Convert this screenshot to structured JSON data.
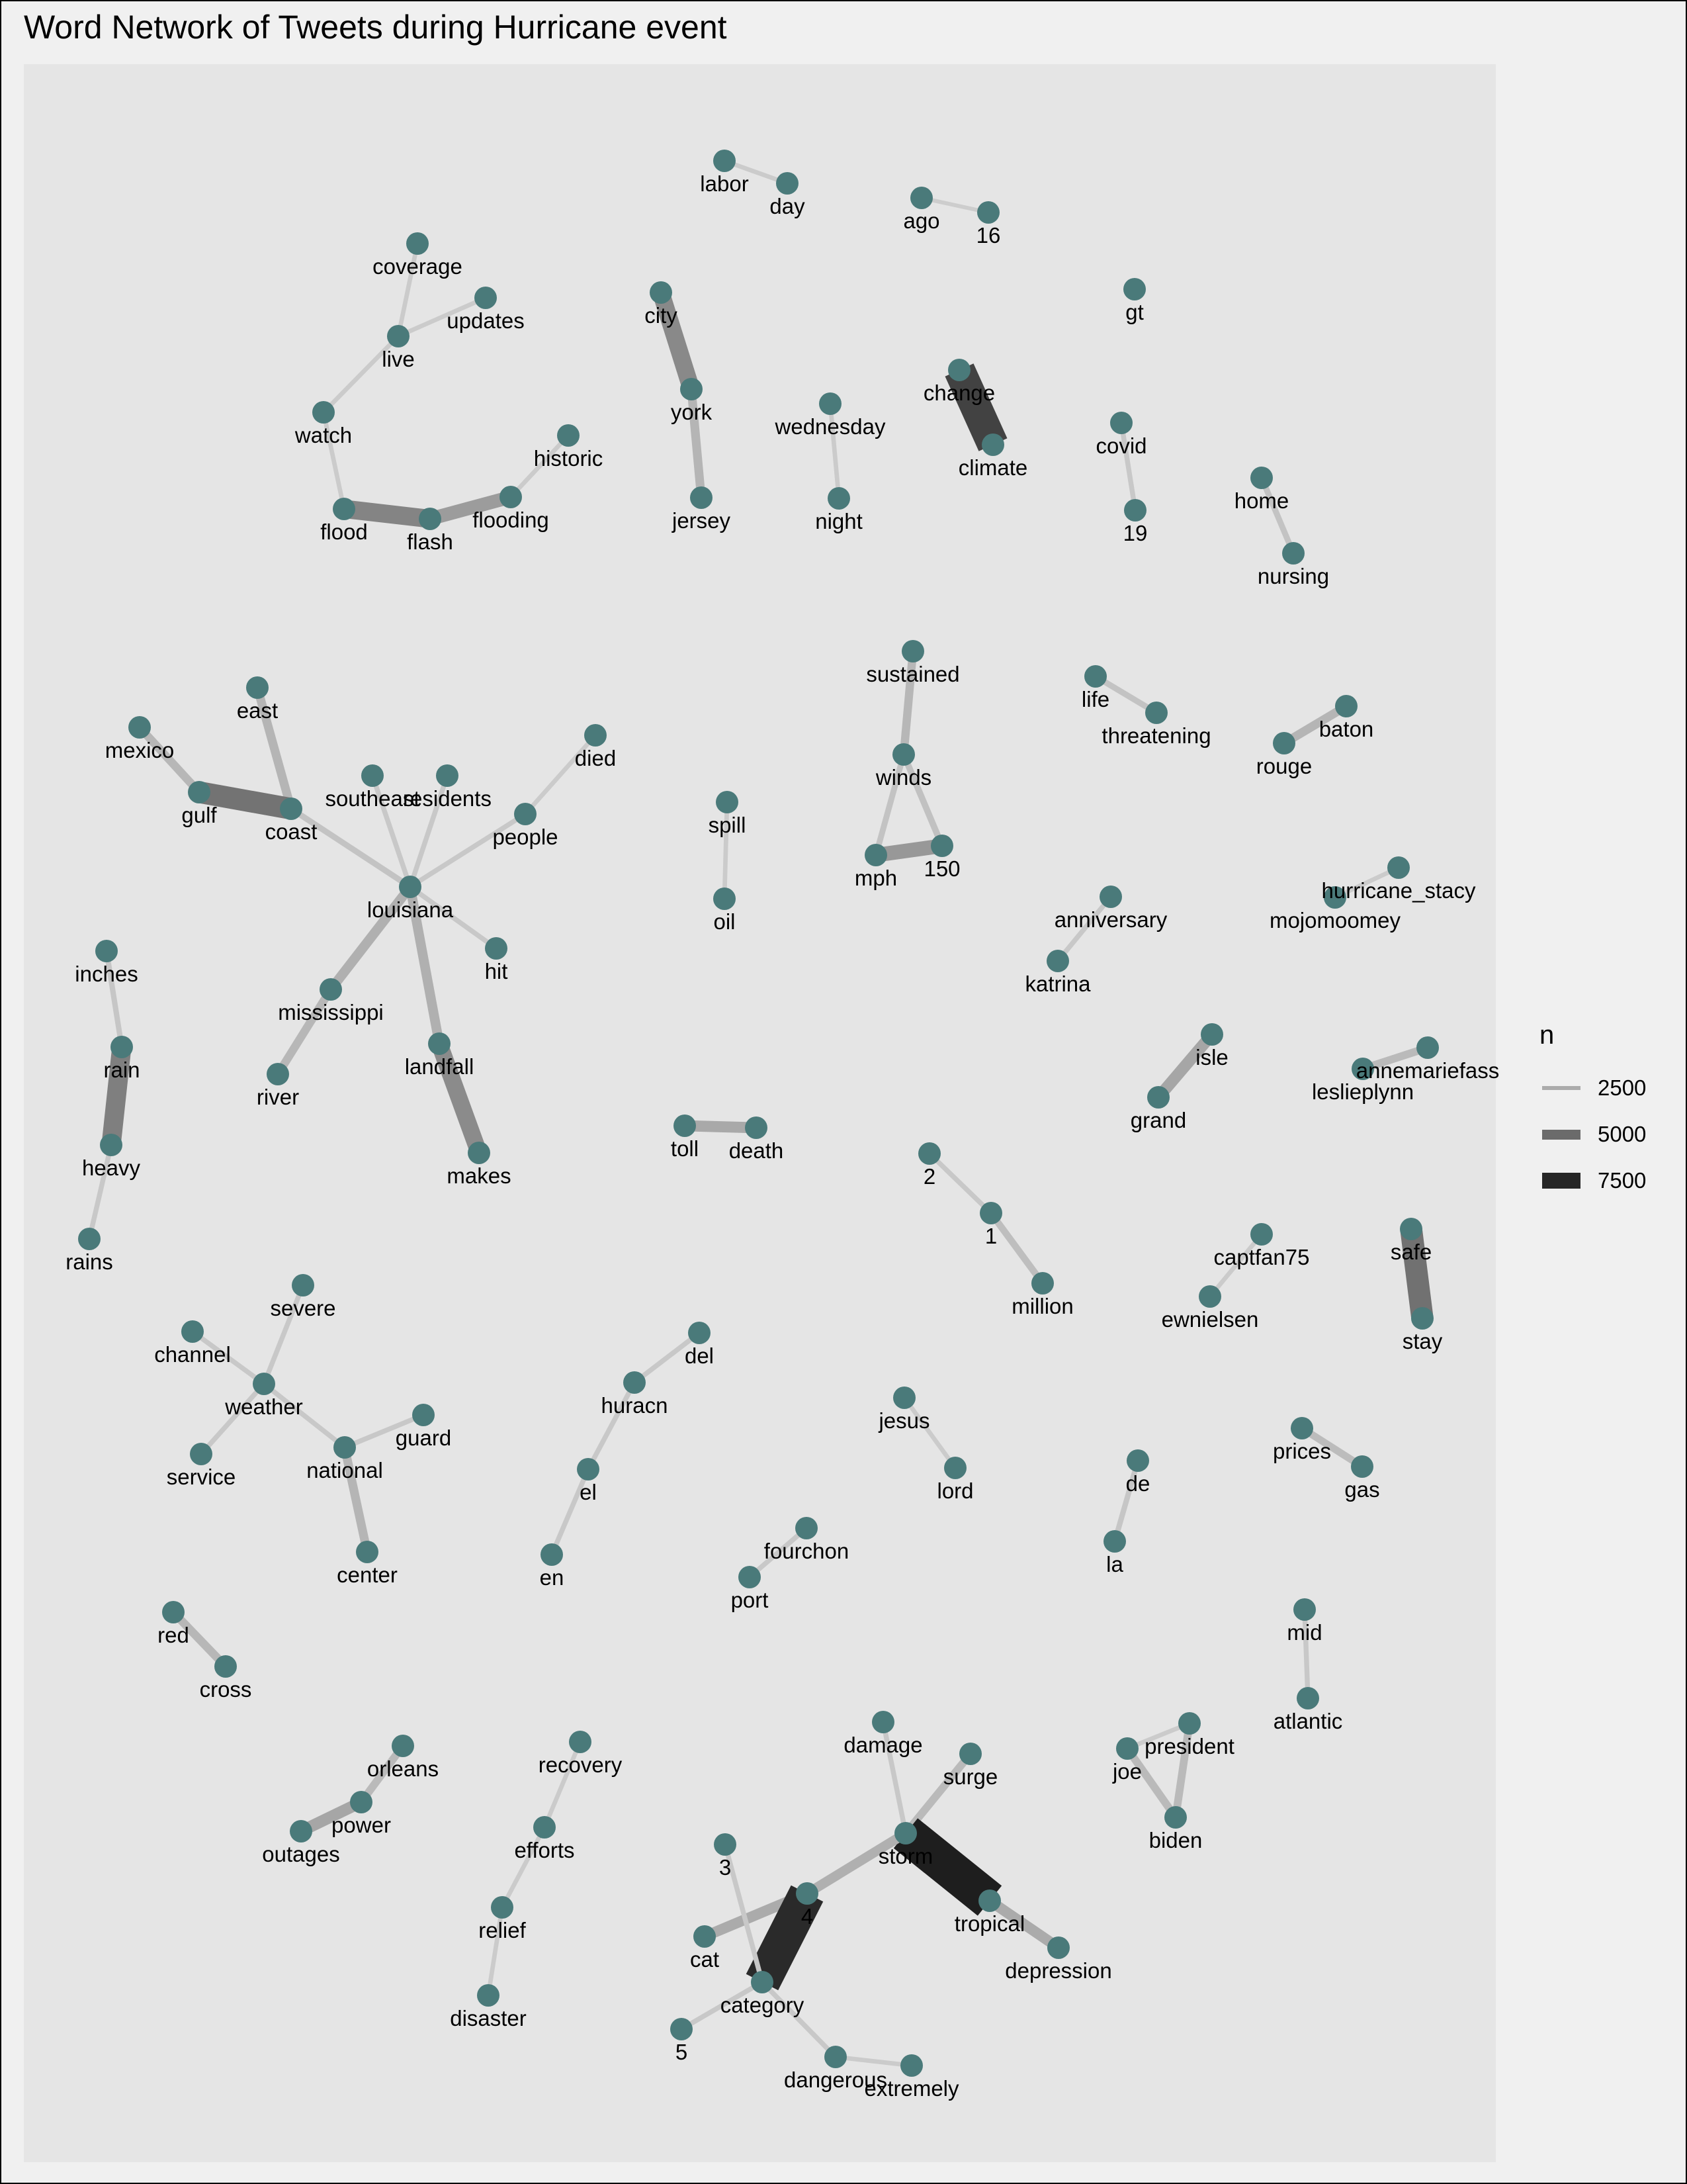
{
  "title": "Word Network of Tweets during Hurricane event",
  "colors": {
    "background": "#f0f0f0",
    "panel": "#e5e5e5",
    "node": "#4a7a7a"
  },
  "legend": {
    "title": "n",
    "entries": [
      {
        "label": "2500",
        "color": "#ababab",
        "weight": 2500
      },
      {
        "label": "5000",
        "color": "#6b6b6b",
        "weight": 5000
      },
      {
        "label": "7500",
        "color": "#262626",
        "weight": 7500
      }
    ]
  },
  "nodes": [
    {
      "id": "labor",
      "label": "labor"
    },
    {
      "id": "day",
      "label": "day"
    },
    {
      "id": "ago",
      "label": "ago"
    },
    {
      "id": "16",
      "label": "16"
    },
    {
      "id": "gt",
      "label": "gt"
    },
    {
      "id": "coverage",
      "label": "coverage"
    },
    {
      "id": "updates",
      "label": "updates"
    },
    {
      "id": "live",
      "label": "live"
    },
    {
      "id": "watch",
      "label": "watch"
    },
    {
      "id": "flood",
      "label": "flood"
    },
    {
      "id": "flash",
      "label": "flash"
    },
    {
      "id": "flooding",
      "label": "flooding"
    },
    {
      "id": "historic",
      "label": "historic"
    },
    {
      "id": "city",
      "label": "city"
    },
    {
      "id": "york",
      "label": "york"
    },
    {
      "id": "jersey",
      "label": "jersey"
    },
    {
      "id": "wednesday",
      "label": "wednesday"
    },
    {
      "id": "night",
      "label": "night"
    },
    {
      "id": "change",
      "label": "change"
    },
    {
      "id": "climate",
      "label": "climate"
    },
    {
      "id": "covid",
      "label": "covid"
    },
    {
      "id": "19",
      "label": "19"
    },
    {
      "id": "home",
      "label": "home"
    },
    {
      "id": "nursing",
      "label": "nursing"
    },
    {
      "id": "sustained",
      "label": "sustained"
    },
    {
      "id": "winds",
      "label": "winds"
    },
    {
      "id": "mph",
      "label": "mph"
    },
    {
      "id": "150",
      "label": "150"
    },
    {
      "id": "life",
      "label": "life"
    },
    {
      "id": "threatening",
      "label": "threatening"
    },
    {
      "id": "baton",
      "label": "baton"
    },
    {
      "id": "rouge",
      "label": "rouge"
    },
    {
      "id": "east",
      "label": "east"
    },
    {
      "id": "mexico",
      "label": "mexico"
    },
    {
      "id": "gulf",
      "label": "gulf"
    },
    {
      "id": "coast",
      "label": "coast"
    },
    {
      "id": "southeast",
      "label": "southeast"
    },
    {
      "id": "residents",
      "label": "residents"
    },
    {
      "id": "died",
      "label": "died"
    },
    {
      "id": "people",
      "label": "people"
    },
    {
      "id": "louisiana",
      "label": "louisiana"
    },
    {
      "id": "hit",
      "label": "hit"
    },
    {
      "id": "mississippi",
      "label": "mississippi"
    },
    {
      "id": "river",
      "label": "river"
    },
    {
      "id": "landfall",
      "label": "landfall"
    },
    {
      "id": "makes",
      "label": "makes"
    },
    {
      "id": "spill",
      "label": "spill"
    },
    {
      "id": "oil",
      "label": "oil"
    },
    {
      "id": "hurricane_stacy",
      "label": "hurricane_stacy"
    },
    {
      "id": "mojomoomey",
      "label": "mojomoomey"
    },
    {
      "id": "anniversary",
      "label": "anniversary"
    },
    {
      "id": "katrina",
      "label": "katrina"
    },
    {
      "id": "inches",
      "label": "inches"
    },
    {
      "id": "rain",
      "label": "rain"
    },
    {
      "id": "heavy",
      "label": "heavy"
    },
    {
      "id": "rains",
      "label": "rains"
    },
    {
      "id": "isle",
      "label": "isle"
    },
    {
      "id": "grand",
      "label": "grand"
    },
    {
      "id": "annemariefass",
      "label": "annemariefass"
    },
    {
      "id": "leslieplynn",
      "label": "leslieplynn"
    },
    {
      "id": "toll",
      "label": "toll"
    },
    {
      "id": "death",
      "label": "death"
    },
    {
      "id": "2",
      "label": "2"
    },
    {
      "id": "1",
      "label": "1"
    },
    {
      "id": "million",
      "label": "million"
    },
    {
      "id": "captfan75",
      "label": "captfan75"
    },
    {
      "id": "ewnielsen",
      "label": "ewnielsen"
    },
    {
      "id": "safe",
      "label": "safe"
    },
    {
      "id": "stay",
      "label": "stay"
    },
    {
      "id": "severe",
      "label": "severe"
    },
    {
      "id": "channel",
      "label": "channel"
    },
    {
      "id": "weather",
      "label": "weather"
    },
    {
      "id": "service",
      "label": "service"
    },
    {
      "id": "guard",
      "label": "guard"
    },
    {
      "id": "national",
      "label": "national"
    },
    {
      "id": "center",
      "label": "center"
    },
    {
      "id": "del",
      "label": "del"
    },
    {
      "id": "huracn",
      "label": "huracn"
    },
    {
      "id": "el",
      "label": "el"
    },
    {
      "id": "en",
      "label": "en"
    },
    {
      "id": "jesus",
      "label": "jesus"
    },
    {
      "id": "lord",
      "label": "lord"
    },
    {
      "id": "de",
      "label": "de"
    },
    {
      "id": "la",
      "label": "la"
    },
    {
      "id": "prices",
      "label": "prices"
    },
    {
      "id": "gas",
      "label": "gas"
    },
    {
      "id": "fourchon",
      "label": "fourchon"
    },
    {
      "id": "port",
      "label": "port"
    },
    {
      "id": "mid",
      "label": "mid"
    },
    {
      "id": "atlantic",
      "label": "atlantic"
    },
    {
      "id": "red",
      "label": "red"
    },
    {
      "id": "cross",
      "label": "cross"
    },
    {
      "id": "orleans",
      "label": "orleans"
    },
    {
      "id": "power",
      "label": "power"
    },
    {
      "id": "outages",
      "label": "outages"
    },
    {
      "id": "recovery",
      "label": "recovery"
    },
    {
      "id": "efforts",
      "label": "efforts"
    },
    {
      "id": "relief",
      "label": "relief"
    },
    {
      "id": "disaster",
      "label": "disaster"
    },
    {
      "id": "damage",
      "label": "damage"
    },
    {
      "id": "surge",
      "label": "surge"
    },
    {
      "id": "storm",
      "label": "storm"
    },
    {
      "id": "tropical",
      "label": "tropical"
    },
    {
      "id": "depression",
      "label": "depression"
    },
    {
      "id": "3",
      "label": "3"
    },
    {
      "id": "4",
      "label": "4"
    },
    {
      "id": "cat",
      "label": "cat"
    },
    {
      "id": "category",
      "label": "category"
    },
    {
      "id": "5",
      "label": "5"
    },
    {
      "id": "dangerous",
      "label": "dangerous"
    },
    {
      "id": "extremely",
      "label": "extremely"
    },
    {
      "id": "president",
      "label": "president"
    },
    {
      "id": "joe",
      "label": "joe"
    },
    {
      "id": "biden",
      "label": "biden"
    }
  ],
  "edges": [
    {
      "from": "labor",
      "to": "day",
      "n": 900
    },
    {
      "from": "ago",
      "to": "16",
      "n": 800
    },
    {
      "from": "coverage",
      "to": "live",
      "n": 900
    },
    {
      "from": "updates",
      "to": "live",
      "n": 900
    },
    {
      "from": "live",
      "to": "watch",
      "n": 900
    },
    {
      "from": "watch",
      "to": "flood",
      "n": 900
    },
    {
      "from": "flood",
      "to": "flash",
      "n": 3800
    },
    {
      "from": "flash",
      "to": "flooding",
      "n": 2800
    },
    {
      "from": "flooding",
      "to": "historic",
      "n": 900
    },
    {
      "from": "city",
      "to": "york",
      "n": 3600
    },
    {
      "from": "york",
      "to": "jersey",
      "n": 1800
    },
    {
      "from": "wednesday",
      "to": "night",
      "n": 900
    },
    {
      "from": "change",
      "to": "climate",
      "n": 6500
    },
    {
      "from": "covid",
      "to": "19",
      "n": 1000
    },
    {
      "from": "home",
      "to": "nursing",
      "n": 1200
    },
    {
      "from": "sustained",
      "to": "winds",
      "n": 1700
    },
    {
      "from": "winds",
      "to": "mph",
      "n": 1200
    },
    {
      "from": "winds",
      "to": "150",
      "n": 1300
    },
    {
      "from": "mph",
      "to": "150",
      "n": 3000
    },
    {
      "from": "life",
      "to": "threatening",
      "n": 1200
    },
    {
      "from": "baton",
      "to": "rouge",
      "n": 1800
    },
    {
      "from": "east",
      "to": "coast",
      "n": 1800
    },
    {
      "from": "mexico",
      "to": "gulf",
      "n": 1700
    },
    {
      "from": "gulf",
      "to": "coast",
      "n": 4500
    },
    {
      "from": "coast",
      "to": "louisiana",
      "n": 1200
    },
    {
      "from": "southeast",
      "to": "louisiana",
      "n": 1000
    },
    {
      "from": "residents",
      "to": "louisiana",
      "n": 1000
    },
    {
      "from": "people",
      "to": "louisiana",
      "n": 1000
    },
    {
      "from": "died",
      "to": "people",
      "n": 900
    },
    {
      "from": "louisiana",
      "to": "hit",
      "n": 1000
    },
    {
      "from": "louisiana",
      "to": "mississippi",
      "n": 2000
    },
    {
      "from": "mississippi",
      "to": "river",
      "n": 1700
    },
    {
      "from": "louisiana",
      "to": "landfall",
      "n": 2000
    },
    {
      "from": "landfall",
      "to": "makes",
      "n": 3500
    },
    {
      "from": "spill",
      "to": "oil",
      "n": 900
    },
    {
      "from": "hurricane_stacy",
      "to": "mojomoomey",
      "n": 900
    },
    {
      "from": "anniversary",
      "to": "katrina",
      "n": 1000
    },
    {
      "from": "inches",
      "to": "rain",
      "n": 1100
    },
    {
      "from": "rain",
      "to": "heavy",
      "n": 4000
    },
    {
      "from": "heavy",
      "to": "rains",
      "n": 1000
    },
    {
      "from": "isle",
      "to": "grand",
      "n": 2400
    },
    {
      "from": "annemariefass",
      "to": "leslieplynn",
      "n": 1600
    },
    {
      "from": "toll",
      "to": "death",
      "n": 2300
    },
    {
      "from": "2",
      "to": "1",
      "n": 1000
    },
    {
      "from": "1",
      "to": "million",
      "n": 1400
    },
    {
      "from": "captfan75",
      "to": "ewnielsen",
      "n": 900
    },
    {
      "from": "safe",
      "to": "stay",
      "n": 4600
    },
    {
      "from": "severe",
      "to": "weather",
      "n": 1000
    },
    {
      "from": "channel",
      "to": "weather",
      "n": 1000
    },
    {
      "from": "weather",
      "to": "service",
      "n": 1000
    },
    {
      "from": "weather",
      "to": "national",
      "n": 1000
    },
    {
      "from": "national",
      "to": "guard",
      "n": 1000
    },
    {
      "from": "national",
      "to": "center",
      "n": 1800
    },
    {
      "from": "del",
      "to": "huracn",
      "n": 1000
    },
    {
      "from": "huracn",
      "to": "el",
      "n": 1000
    },
    {
      "from": "el",
      "to": "en",
      "n": 1000
    },
    {
      "from": "jesus",
      "to": "lord",
      "n": 900
    },
    {
      "from": "de",
      "to": "la",
      "n": 1100
    },
    {
      "from": "prices",
      "to": "gas",
      "n": 1500
    },
    {
      "from": "fourchon",
      "to": "port",
      "n": 1000
    },
    {
      "from": "mid",
      "to": "atlantic",
      "n": 1000
    },
    {
      "from": "red",
      "to": "cross",
      "n": 1700
    },
    {
      "from": "orleans",
      "to": "power",
      "n": 1600
    },
    {
      "from": "power",
      "to": "outages",
      "n": 2400
    },
    {
      "from": "recovery",
      "to": "efforts",
      "n": 900
    },
    {
      "from": "efforts",
      "to": "relief",
      "n": 900
    },
    {
      "from": "relief",
      "to": "disaster",
      "n": 900
    },
    {
      "from": "damage",
      "to": "storm",
      "n": 1000
    },
    {
      "from": "surge",
      "to": "storm",
      "n": 1600
    },
    {
      "from": "storm",
      "to": "tropical",
      "n": 8000
    },
    {
      "from": "tropical",
      "to": "depression",
      "n": 2200
    },
    {
      "from": "storm",
      "to": "4",
      "n": 2000
    },
    {
      "from": "cat",
      "to": "4",
      "n": 2200
    },
    {
      "from": "4",
      "to": "category",
      "n": 7500
    },
    {
      "from": "3",
      "to": "category",
      "n": 1000
    },
    {
      "from": "category",
      "to": "5",
      "n": 1000
    },
    {
      "from": "category",
      "to": "dangerous",
      "n": 1000
    },
    {
      "from": "dangerous",
      "to": "extremely",
      "n": 900
    },
    {
      "from": "president",
      "to": "joe",
      "n": 900
    },
    {
      "from": "president",
      "to": "biden",
      "n": 1600
    },
    {
      "from": "joe",
      "to": "biden",
      "n": 1600
    }
  ]
}
